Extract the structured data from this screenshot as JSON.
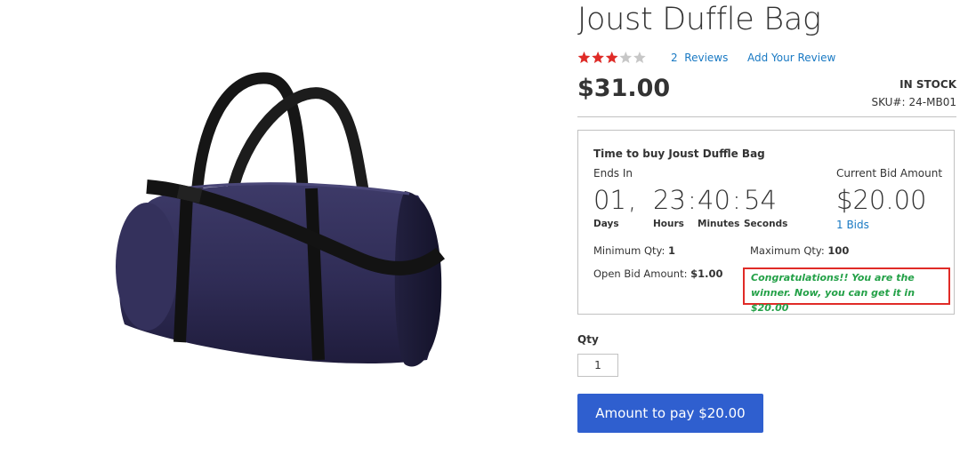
{
  "product": {
    "name": "Joust Duffle Bag",
    "rating_percent": 60,
    "reviews_count": "2",
    "reviews_label": "Reviews",
    "add_review": "Add Your Review",
    "price": "$31.00",
    "stock": "IN STOCK",
    "sku_label": "SKU#:",
    "sku": "24-MB01"
  },
  "auction": {
    "title": "Time to buy Joust Duffle Bag",
    "ends_in": "Ends In",
    "days": "01",
    "sep1": ",",
    "hours": "23",
    "sep2": ":",
    "minutes": "40",
    "sep3": ":",
    "seconds": "54",
    "days_label": "Days",
    "hours_label": "Hours",
    "minutes_label": "Minutes",
    "seconds_label": "Seconds",
    "current_bid_label": "Current Bid Amount",
    "current_bid": "$20.00",
    "bids": "1 Bids",
    "min_qty_label": "Minimum Qty:",
    "min_qty": "1",
    "max_qty_label": "Maximum Qty:",
    "max_qty": "100",
    "open_bid_label": "Open Bid Amount:",
    "open_bid": "$1.00",
    "message": "Congratulations!! You are the winner. Now, you can get it in $20.00"
  },
  "purchase": {
    "qty_label": "Qty",
    "qty_value": "1",
    "pay_button": "Amount to pay $20.00"
  },
  "colors": {
    "link": "#1979c3",
    "star": "#e02b27",
    "success": "#24a148",
    "alert_border": "#e02b27",
    "button": "#2f5fcf"
  }
}
